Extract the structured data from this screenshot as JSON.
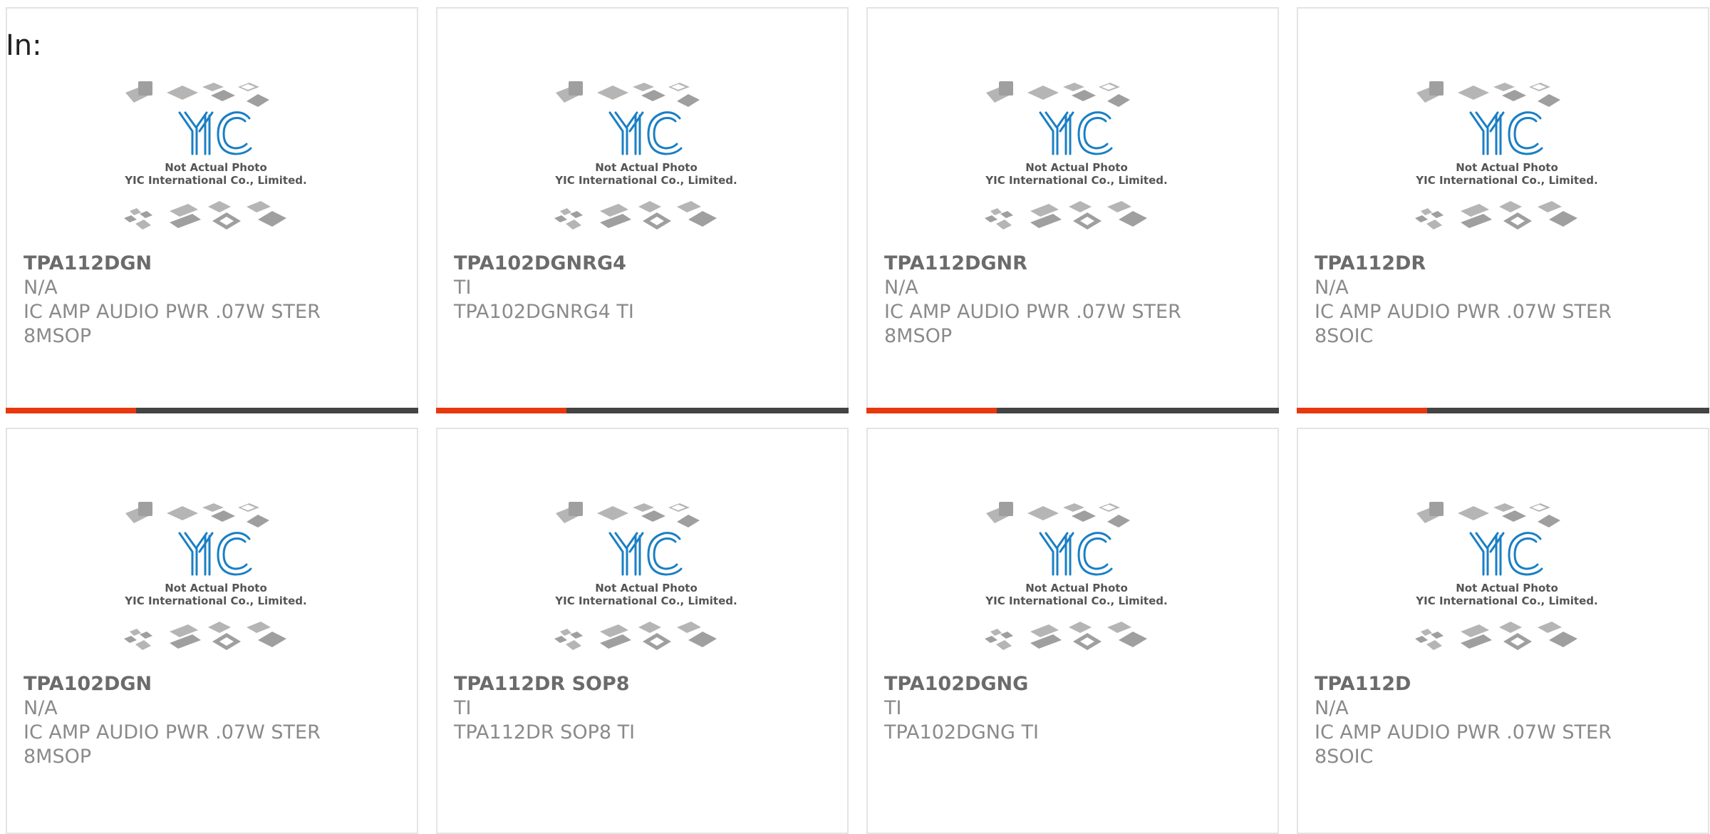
{
  "header": {
    "label": "In:"
  },
  "placeholder_image": {
    "logo_text": "YIC",
    "caption_line1": "Not Actual Photo",
    "caption_line2": "YIC International Co., Limited.",
    "logo_color": "#1a7fc4"
  },
  "colors": {
    "accent": "#e8380d",
    "bar": "#444444"
  },
  "products": [
    {
      "part": "TPA112DGN",
      "mfr": "N/A",
      "desc": "IC AMP AUDIO PWR .07W STER 8MSOP"
    },
    {
      "part": "TPA102DGNRG4",
      "mfr": "TI",
      "desc": "TPA102DGNRG4 TI"
    },
    {
      "part": "TPA112DGNR",
      "mfr": "N/A",
      "desc": "IC AMP AUDIO PWR .07W STER 8MSOP"
    },
    {
      "part": "TPA112DR",
      "mfr": "N/A",
      "desc": "IC AMP AUDIO PWR .07W STER 8SOIC"
    },
    {
      "part": "TPA102DGN",
      "mfr": "N/A",
      "desc": "IC AMP AUDIO PWR .07W STER 8MSOP"
    },
    {
      "part": "TPA112DR SOP8",
      "mfr": "TI",
      "desc": "TPA112DR SOP8 TI"
    },
    {
      "part": "TPA102DGNG",
      "mfr": "TI",
      "desc": "TPA102DGNG TI"
    },
    {
      "part": "TPA112D",
      "mfr": "N/A",
      "desc": "IC AMP AUDIO PWR .07W STER 8SOIC"
    }
  ]
}
